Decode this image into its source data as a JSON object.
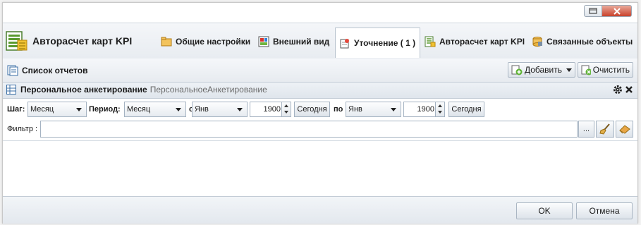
{
  "app": {
    "title": "Авторасчет карт KPI"
  },
  "tabs": [
    {
      "label": "Общие настройки",
      "icon": "settings-folder-icon"
    },
    {
      "label": "Внешний вид",
      "icon": "appearance-icon"
    },
    {
      "label": "Уточнение ( 1 )",
      "icon": "filter-refine-icon",
      "active": true
    },
    {
      "label": "Авторасчет карт KPI",
      "icon": "kpi-calc-icon"
    },
    {
      "label": "Связанные объекты",
      "icon": "linked-objects-icon"
    }
  ],
  "toolbar": {
    "title": "Список отчетов",
    "add_label": "Добавить",
    "clear_label": "Очистить"
  },
  "panel": {
    "title": "Персональное анкетирование",
    "subtitle": "ПерсональноеАнкетирование"
  },
  "period": {
    "step_label": "Шаг:",
    "step_value": "Месяц",
    "period_label": "Период:",
    "period_value": "Месяц",
    "from_label": "с",
    "from_month": "Янв",
    "from_year": "1900",
    "from_today": "Сегодня",
    "to_label": "по",
    "to_month": "Янв",
    "to_year": "1900",
    "to_today": "Сегодня"
  },
  "filter": {
    "label": "Фильтр :",
    "value": "",
    "ellipsis": "..."
  },
  "footer": {
    "ok_label": "OK",
    "cancel_label": "Отмена"
  },
  "colors": {
    "accent": "#c8412b",
    "border": "#a5b3c2",
    "header_bg": "#e8ecf1"
  }
}
